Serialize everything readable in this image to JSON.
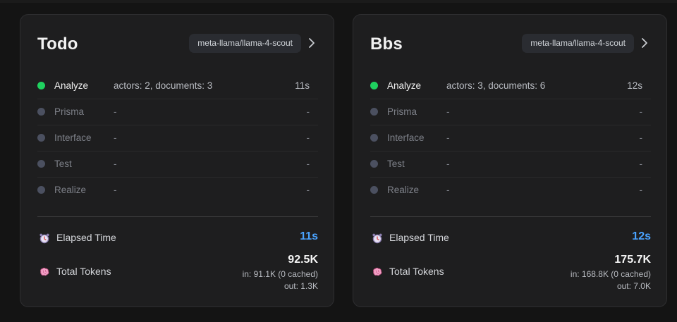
{
  "cards": [
    {
      "title": "Todo",
      "model": "meta-llama/llama-4-scout",
      "steps": [
        {
          "name": "Analyze",
          "detail": "actors: 2, documents: 3",
          "time": "11s",
          "status": "done"
        },
        {
          "name": "Prisma",
          "detail": "-",
          "time": "-",
          "status": "pending"
        },
        {
          "name": "Interface",
          "detail": "-",
          "time": "-",
          "status": "pending"
        },
        {
          "name": "Test",
          "detail": "-",
          "time": "-",
          "status": "pending"
        },
        {
          "name": "Realize",
          "detail": "-",
          "time": "-",
          "status": "pending"
        }
      ],
      "elapsed_label": "Elapsed Time",
      "elapsed_value": "11s",
      "tokens_label": "Total Tokens",
      "tokens_total": "92.5K",
      "tokens_in": "in: 91.1K (0 cached)",
      "tokens_out": "out: 1.3K"
    },
    {
      "title": "Bbs",
      "model": "meta-llama/llama-4-scout",
      "steps": [
        {
          "name": "Analyze",
          "detail": "actors: 3, documents: 6",
          "time": "12s",
          "status": "done"
        },
        {
          "name": "Prisma",
          "detail": "-",
          "time": "-",
          "status": "pending"
        },
        {
          "name": "Interface",
          "detail": "-",
          "time": "-",
          "status": "pending"
        },
        {
          "name": "Test",
          "detail": "-",
          "time": "-",
          "status": "pending"
        },
        {
          "name": "Realize",
          "detail": "-",
          "time": "-",
          "status": "pending"
        }
      ],
      "elapsed_label": "Elapsed Time",
      "elapsed_value": "12s",
      "tokens_label": "Total Tokens",
      "tokens_total": "175.7K",
      "tokens_in": "in: 168.8K (0 cached)",
      "tokens_out": "out: 7.0K"
    }
  ],
  "colors": {
    "active_dot": "#1fd15f",
    "pending_dot": "#4b5060",
    "elapsed_accent": "#4aa3ff"
  },
  "icons": {
    "elapsed": "alarm-clock-icon",
    "tokens": "brain-icon",
    "open": "chevron-right-icon"
  }
}
